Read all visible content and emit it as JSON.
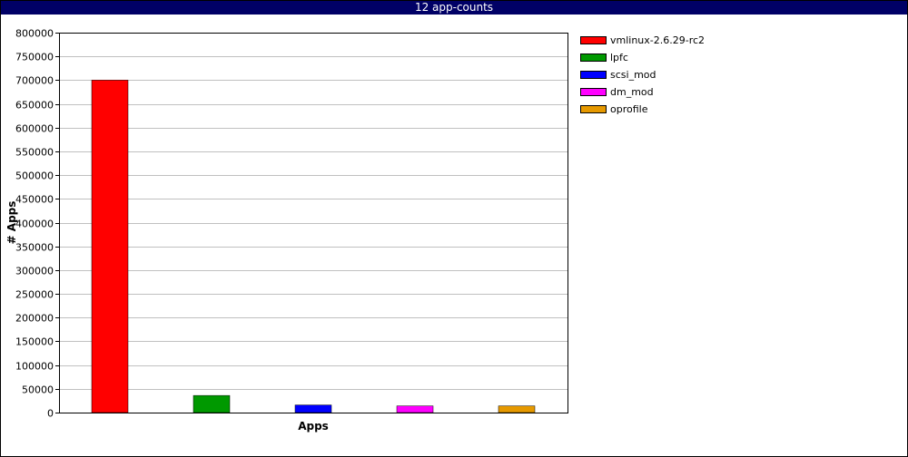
{
  "window": {
    "title": "12 app-counts"
  },
  "colors": {
    "titlebar": "#000066",
    "grid": "#c0c0c0",
    "axis": "#000000"
  },
  "chart_data": {
    "type": "bar",
    "title": "12 app-counts",
    "xlabel": "Apps",
    "ylabel": "# Apps",
    "ylim": [
      0,
      800000
    ],
    "yticks": [
      0,
      50000,
      100000,
      150000,
      200000,
      250000,
      300000,
      350000,
      400000,
      450000,
      500000,
      550000,
      600000,
      650000,
      700000,
      750000,
      800000
    ],
    "grid": true,
    "legend_position": "right",
    "series": [
      {
        "name": "vmlinux-2.6.29-rc2",
        "value": 700000,
        "color": "#ff0000"
      },
      {
        "name": "lpfc",
        "value": 36000,
        "color": "#009900"
      },
      {
        "name": "scsi_mod",
        "value": 16000,
        "color": "#0000ff"
      },
      {
        "name": "dm_mod",
        "value": 14000,
        "color": "#ff00ff"
      },
      {
        "name": "oprofile",
        "value": 14000,
        "color": "#e69900"
      }
    ]
  }
}
